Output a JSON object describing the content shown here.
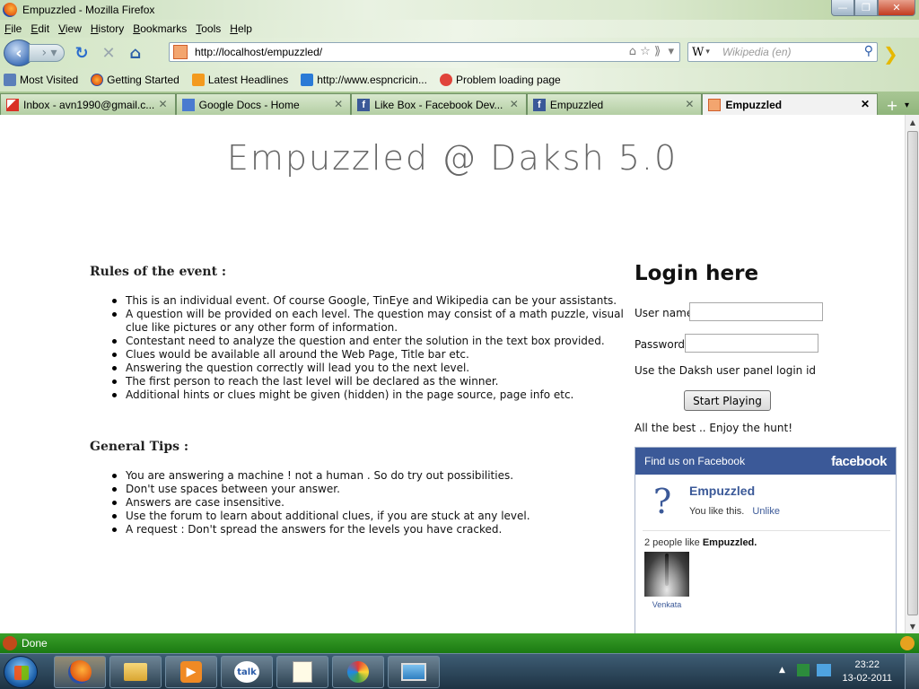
{
  "window": {
    "title": "Empuzzled - Mozilla Firefox"
  },
  "menu": [
    "File",
    "Edit",
    "View",
    "History",
    "Bookmarks",
    "Tools",
    "Help"
  ],
  "nav": {
    "url": "http://localhost/empuzzled/",
    "search_engine": "W",
    "search_placeholder": "Wikipedia (en)"
  },
  "bookmarks": [
    {
      "label": "Most Visited",
      "icon": "bookmark-icon"
    },
    {
      "label": "Getting Started",
      "icon": "firefox-icon"
    },
    {
      "label": "Latest Headlines",
      "icon": "rss-icon"
    },
    {
      "label": "http://www.espncricin...",
      "icon": "espn-icon"
    },
    {
      "label": "Problem loading page",
      "icon": "error-icon"
    }
  ],
  "tabs": [
    {
      "label": "Inbox - avn1990@gmail.c...",
      "icon": "gmail-icon",
      "active": false
    },
    {
      "label": "Google Docs - Home",
      "icon": "docs-icon",
      "active": false
    },
    {
      "label": "Like Box - Facebook Dev...",
      "icon": "facebook-icon",
      "active": false
    },
    {
      "label": "Empuzzled",
      "icon": "facebook-icon",
      "active": false
    },
    {
      "label": "Empuzzled",
      "icon": "site-icon",
      "active": true
    }
  ],
  "page": {
    "title": "Empuzzled @ Daksh 5.0",
    "rules_heading": "Rules of the event :",
    "rules": [
      "This is an individual event. Of course Google, TinEye and Wikipedia can be your assistants.",
      "A question will be provided on each level. The question may consist of a math puzzle, visual clue like pictures or any other form of information.",
      "Contestant need to analyze the question and enter the solution in the text box provided.",
      "Clues would be available all around the Web Page, Title bar etc.",
      "Answering the question correctly will lead you to the next level.",
      "The first person to reach the last level will be declared as the winner.",
      "Additional hints or clues might be given (hidden) in the page source, page info etc."
    ],
    "tips_heading": "General Tips :",
    "tips": [
      "You are answering a machine ! not a human . So do try out possibilities.",
      "Don't use spaces between your answer.",
      "Answers are case insensitive.",
      "Use the forum to learn about additional clues, if you are stuck at any level.",
      "A request : Don't spread the answers for the levels you have cracked."
    ],
    "login": {
      "heading": "Login here",
      "username_label": "User name",
      "password_label": "Password",
      "note": "Use the Daksh user panel login id",
      "button": "Start Playing",
      "best": "All the best .. Enjoy the hunt!"
    },
    "facebook": {
      "header": "Find us on Facebook",
      "logo": "facebook",
      "page_name": "Empuzzled",
      "you_like": "You like this.",
      "unlike": "Unlike",
      "count_prefix": "2 people like ",
      "count_name": "Empuzzled.",
      "friend_name": "Venkata"
    }
  },
  "status": {
    "text": "Done"
  },
  "taskbar": {
    "time": "23:22",
    "date": "13-02-2011"
  }
}
